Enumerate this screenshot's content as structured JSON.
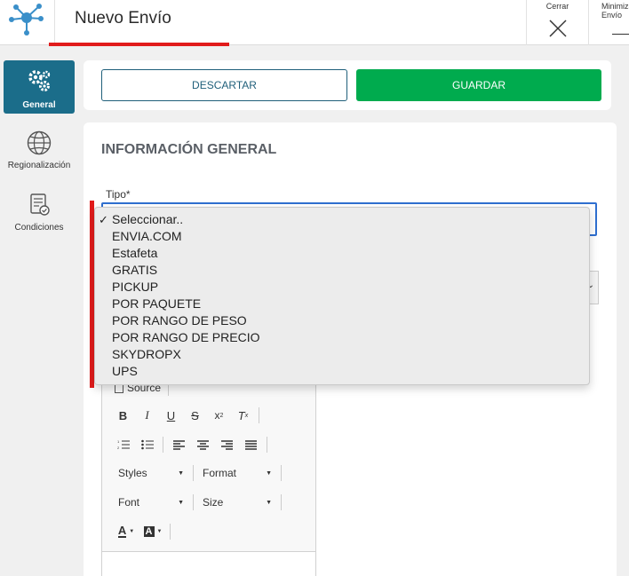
{
  "header": {
    "title": "Nuevo Envío",
    "close_label": "Cerrar",
    "minimize_label": "Minimiza\nEnvío"
  },
  "sidebar": {
    "items": [
      {
        "label": "General",
        "icon": "gears-icon",
        "active": true
      },
      {
        "label": "Regionalización",
        "icon": "globe-icon",
        "active": false
      },
      {
        "label": "Condiciones",
        "icon": "document-check-icon",
        "active": false
      }
    ]
  },
  "actions": {
    "discard_label": "DESCARTAR",
    "save_label": "GUARDAR"
  },
  "main": {
    "section_title": "INFORMACIÓN GENERAL",
    "tipo_label": "Tipo*"
  },
  "dropdown": {
    "options": [
      "Seleccionar..",
      "ENVIA.COM",
      "Estafeta",
      "GRATIS",
      "PICKUP",
      "POR PAQUETE",
      "POR RANGO DE PESO",
      "POR RANGO DE PRECIO",
      "SKYDROPX",
      "UPS"
    ],
    "selected_index": 0
  },
  "editor": {
    "source_label": "Source",
    "styles_label": "Styles",
    "format_label": "Format",
    "font_label": "Font",
    "size_label": "Size"
  },
  "colors": {
    "accent": "#1b6d8a",
    "save": "#00ab4e",
    "highlight": "#e11b1b",
    "focus": "#2f6fd0"
  }
}
